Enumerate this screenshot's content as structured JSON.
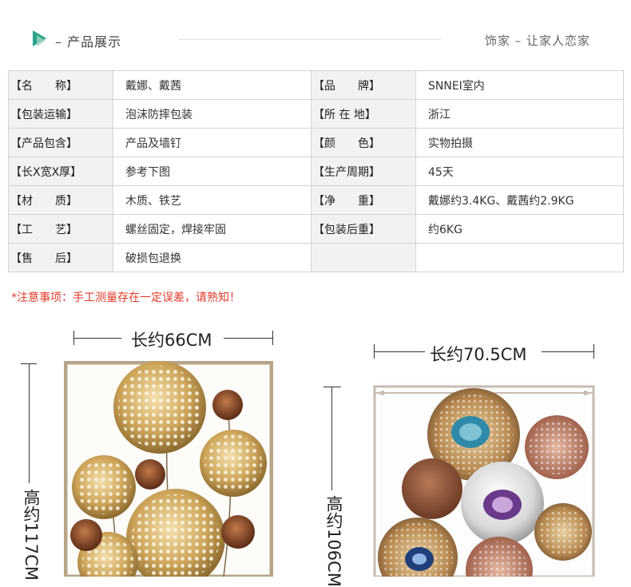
{
  "header": {
    "title": "– 产品展示",
    "slogan": "饰家 – 让家人恋家"
  },
  "specs": [
    [
      {
        "label": "【名　　称】",
        "value": "戴娜、戴茜"
      },
      {
        "label": "【品　　牌】",
        "value": "SNNEI室内"
      }
    ],
    [
      {
        "label": "【包装运输】",
        "value": "泡沫防摔包装"
      },
      {
        "label": "【所 在 地】",
        "value": "浙江"
      }
    ],
    [
      {
        "label": "【产品包含】",
        "value": "产品及墙钉"
      },
      {
        "label": "【颜　　色】",
        "value": "实物拍摄"
      }
    ],
    [
      {
        "label": "【长X宽X厚】",
        "value": "参考下图"
      },
      {
        "label": "【生产周期】",
        "value": "45天"
      }
    ],
    [
      {
        "label": "【材　　质】",
        "value": "木质、铁艺"
      },
      {
        "label": "【净　　重】",
        "value": "戴娜约3.4KG、戴茜约2.9KG"
      }
    ],
    [
      {
        "label": "【工　　艺】",
        "value": "螺丝固定，焊接牢固"
      },
      {
        "label": "【包装后重】",
        "value": "约6KG"
      }
    ],
    [
      {
        "label": "【售　　后】",
        "value": "破损包退换"
      },
      {
        "label": "",
        "value": ""
      }
    ]
  ],
  "notice": "*注意事项：手工测量存在一定误差，请熟知！",
  "products": {
    "left": {
      "width_label": "长约66CM",
      "height_label": "高约117CM"
    },
    "right": {
      "width_label": "长约70.5CM",
      "height_label": "高约106CM"
    }
  },
  "colors": {
    "accent": "#2aa58a",
    "notice": "#e23a2a",
    "gold": "#c9a45c",
    "copper": "#8a4a2a",
    "agate_blue": "#2f8aa8",
    "agate_purple": "#6a3a8a"
  }
}
